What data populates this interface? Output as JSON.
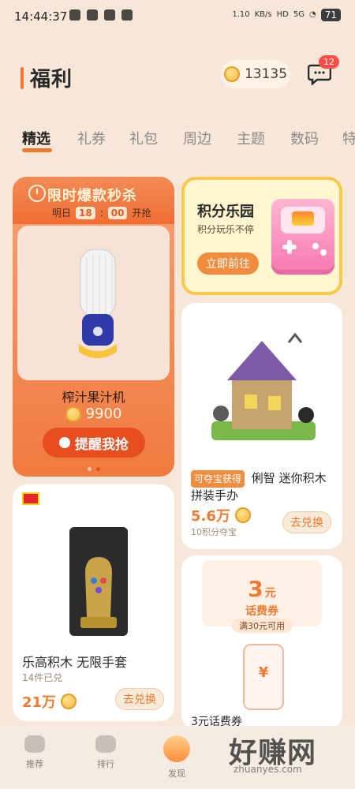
{
  "statusbar": {
    "time": "14:44:37",
    "network_speed_value": "1.10",
    "network_speed_unit": "KB/s",
    "hd": "HD",
    "signal": "5G",
    "battery": "71"
  },
  "header": {
    "title": "福利",
    "points": "13135",
    "message_badge": "12"
  },
  "tabs": [
    "精选",
    "礼券",
    "礼包",
    "周边",
    "主题",
    "数码",
    "特"
  ],
  "promo": {
    "banner_title": "限时爆款秒杀",
    "countdown_prefix": "明日",
    "countdown_hour": "18",
    "countdown_minute": "00",
    "countdown_suffix": "开抢",
    "product_name": "榨汁果汁机",
    "price": "9900",
    "button_label": "提醒我抢"
  },
  "park": {
    "title": "积分乐园",
    "subtitle": "积分玩乐不停",
    "button_label": "立即前往"
  },
  "lego_small": {
    "tag": "可夺宝获得",
    "title": "俐智 迷你积木拼装手办",
    "price": "5.6万",
    "sub": "10积分夺宝",
    "button_label": "去兑换"
  },
  "lego_gauntlet": {
    "badge": "LEGO",
    "title": "乐高积木 无限手套",
    "sub": "14件已兑",
    "price": "21万",
    "button_label": "去兑换"
  },
  "coupon": {
    "value": "3",
    "unit": "元",
    "name": "话费券",
    "condition": "满30元可用",
    "footer_title": "3元话费券"
  },
  "bottom_nav": {
    "items": [
      "推荐",
      "排行",
      "发现"
    ]
  },
  "watermark": {
    "main": "好赚网",
    "sub": "zhuanyes.com"
  },
  "colors": {
    "accent": "#f07a2f",
    "promo_bg": "#f07a3f",
    "park_border": "#f7c84a",
    "badge_red": "#ff4d45"
  }
}
